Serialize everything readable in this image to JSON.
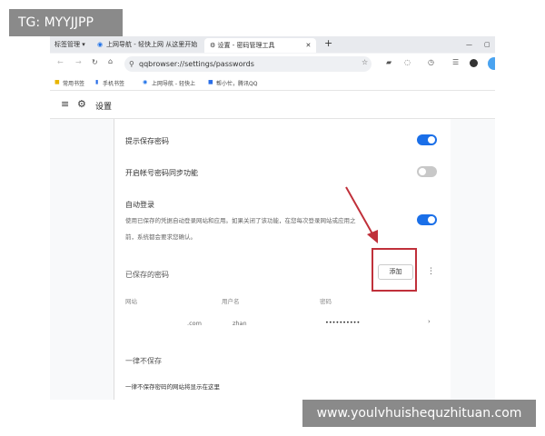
{
  "overlays": {
    "top_left": "TG: MYYJJPP",
    "bottom_right": "www.youlvhuishequzhituan.com"
  },
  "tabs": [
    {
      "label": "标签管理 ▾"
    },
    {
      "label": "上网导航 - 轻快上网 从这里开始"
    },
    {
      "label": "设置 - 密码管理工具",
      "active": true
    }
  ],
  "address": {
    "url": "qqbrowser://settings/passwords"
  },
  "bookmarks": [
    "常用书签",
    "手机书签",
    "上网导航 - 轻快上",
    "帮小忙，腾讯QQ"
  ],
  "header": {
    "title": "设置"
  },
  "settings": [
    {
      "label": "提示保存密码",
      "enabled": true
    },
    {
      "label": "开启帐号密码同步功能",
      "enabled": false
    },
    {
      "label": "自动登录",
      "description_line1": "使用已保存的凭据自动登录网站和应用。如果关闭了该功能，在您每次登录网站或应用之",
      "description_line2": "前，系统都会要求您确认。",
      "enabled": true
    }
  ],
  "saved": {
    "title": "已保存的密码",
    "add_button": "添加",
    "columns": [
      "网站",
      "用户名",
      "密码"
    ],
    "rows": [
      {
        "site": ".com",
        "user": "zhan",
        "password": "••••••••••"
      }
    ]
  },
  "never_save": {
    "title": "一律不保存",
    "empty_text": "一律不保存密码的网站将显示在这里"
  },
  "colors": {
    "accent": "#1a6fe8",
    "highlight_box": "#c0303a",
    "arrow": "#c0303a"
  }
}
